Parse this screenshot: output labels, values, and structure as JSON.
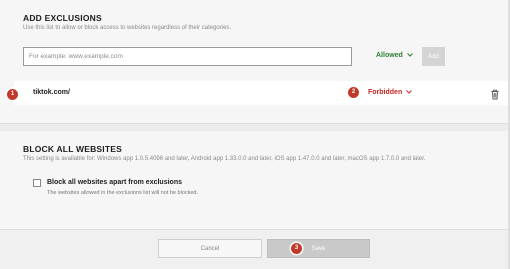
{
  "exclusions": {
    "title": "ADD EXCLUSIONS",
    "description": "Use this list to allow or block access to websites regardless of their categories.",
    "input": {
      "placeholder": "For example: www.example.com",
      "value": ""
    },
    "mode_dropdown": {
      "label": "Allowed",
      "icon": "chevron-down-icon"
    },
    "add_button": "Add",
    "items": [
      {
        "url": "tiktok.com/",
        "status": "Forbidden",
        "status_color": "#c62828"
      }
    ]
  },
  "block_all": {
    "title": "BLOCK ALL WEBSITES",
    "description": "This setting is available for: Windows app 1.0.5.4096 and later, Android app 1.33.0.0 and later, iOS app 1.47.0.0 and later, macOS app 1.7.0.0 and later.",
    "checkbox_label": "Block all websites apart from exclusions",
    "checkbox_checked": false,
    "checkbox_sub": "The websites allowed in the exclusions list will not be blocked."
  },
  "footer": {
    "cancel_label": "Cancel",
    "save_label": "Save"
  },
  "markers": [
    "1",
    "2",
    "3"
  ],
  "colors": {
    "allowed": "#2e7d32",
    "forbidden": "#c62828",
    "marker": "#c0392b"
  }
}
